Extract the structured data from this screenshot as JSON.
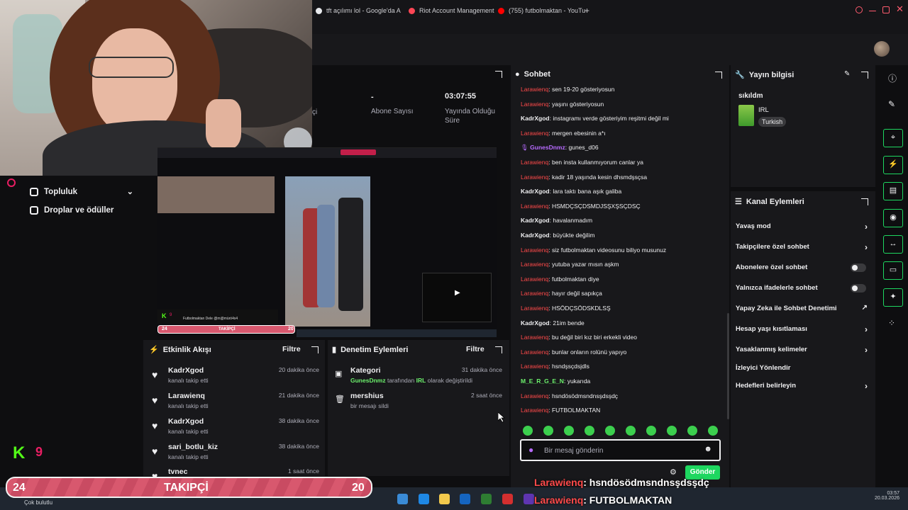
{
  "browser": {
    "tabs": [
      {
        "label": "tft açılımı lol - Google'da A",
        "color": "#e8eaed"
      },
      {
        "label": "Riot Account Management",
        "color": "#ff4655"
      },
      {
        "label": "(755) futbolmaktan - YouTu",
        "color": "#ff0000"
      }
    ],
    "new_tab_label": "+",
    "ai_label": "AI"
  },
  "stats": {
    "viewers_label_partial": "çi",
    "subs_value": "-",
    "subs_label": "Abone Sayısı",
    "uptime_value": "03:07:55",
    "uptime_label": "Yayında Olduğu Süre"
  },
  "leftnav": {
    "community": "Topluluk",
    "drops": "Droplar ve ödüller"
  },
  "preview": {
    "overlay_title": "Futbolmaktan Dele @m@mürö4x4",
    "banner_left": "24",
    "banner_mid": "TAKİPÇİ",
    "banner_right": "20",
    "kick_count": "9"
  },
  "activity": {
    "title": "Etkinlik Akışı",
    "filter": "Filtre",
    "items": [
      {
        "name": "KadrXgod",
        "sub": "kanalı takip etti",
        "time": "20 dakika önce"
      },
      {
        "name": "Larawienq",
        "sub": "kanalı takip etti",
        "time": "21 dakika önce"
      },
      {
        "name": "KadrXgod",
        "sub": "kanalı takip etti",
        "time": "38 dakika önce"
      },
      {
        "name": "sari_botlu_kiz",
        "sub": "kanalı takip etti",
        "time": "38 dakika önce"
      },
      {
        "name": "tvnec",
        "sub": "",
        "time": "1 saat önce"
      }
    ]
  },
  "moderation": {
    "title": "Denetim Eylemleri",
    "filter": "Filtre",
    "items": [
      {
        "name": "Kategori",
        "actor": "GunesDnmz",
        "mid": " tarafından ",
        "target": "IRL",
        "tail": " olarak değiştirildi",
        "time": "31 dakika önce"
      },
      {
        "name": "mershius",
        "sub": "bir mesajı sildi",
        "time": "2 saat önce"
      }
    ]
  },
  "chat": {
    "title": "Sohbet",
    "messages": [
      {
        "user": "Larawienq",
        "type": "lara",
        "text": "sen 19-20 gösteriyosun"
      },
      {
        "user": "Larawienq",
        "type": "lara",
        "text": "yaşını gösteriyosun"
      },
      {
        "user": "KadrXgod",
        "type": "kadr",
        "text": "instagramı verde gösteriyim reşitmi değil mi"
      },
      {
        "user": "Larawienq",
        "type": "lara",
        "text": "mergen ebesinin a*ı"
      },
      {
        "user": "GunesDnmz",
        "type": "gunes",
        "text": "gunes_d06"
      },
      {
        "user": "Larawienq",
        "type": "lara",
        "text": "ben insta kullanmıyorum canlar ya"
      },
      {
        "user": "Larawienq",
        "type": "lara",
        "text": "kadir 18 yaşında kesin dhsmdşsçsa"
      },
      {
        "user": "KadrXgod",
        "type": "kadr",
        "text": "lara taktı bana aşık galiba"
      },
      {
        "user": "Larawienq",
        "type": "lara",
        "text": "HSMDÇSÇDSMDJSŞXŞSÇDSÇ"
      },
      {
        "user": "KadrXgod",
        "type": "kadr",
        "text": "havalanmadım"
      },
      {
        "user": "KadrXgod",
        "type": "kadr",
        "text": "büyükte değilim"
      },
      {
        "user": "Larawienq",
        "type": "lara",
        "text": "siz futbolmaktan videosunu biliyo musunuz"
      },
      {
        "user": "Larawienq",
        "type": "lara",
        "text": "yutuba yazar mısın aşkm"
      },
      {
        "user": "Larawienq",
        "type": "lara",
        "text": "futbolmaktan diye"
      },
      {
        "user": "Larawienq",
        "type": "lara",
        "text": "hayır değil sapıkça"
      },
      {
        "user": "Larawienq",
        "type": "lara",
        "text": "HSÖDÇSÖDSKDLSŞ"
      },
      {
        "user": "KadrXgod",
        "type": "kadr",
        "text": "21im bende"
      },
      {
        "user": "Larawienq",
        "type": "lara",
        "text": "bu değil biri kız biri erkekli video"
      },
      {
        "user": "Larawienq",
        "type": "lara",
        "text": "bunlar onların rolünü yapıyo"
      },
      {
        "user": "Larawienq",
        "type": "lara",
        "text": "hsndşsçdsjdls"
      },
      {
        "user": "M_E_R_G_E_N",
        "type": "merg",
        "text": "yukarıda"
      },
      {
        "user": "Larawienq",
        "type": "lara",
        "text": "hsndösödmsndnsşdsşdç"
      },
      {
        "user": "Larawienq",
        "type": "lara",
        "text": "FUTBOLMAKTAN"
      }
    ],
    "input_placeholder": "Bir mesaj gönderin",
    "send_label": "Gönder"
  },
  "stream_info": {
    "title": "Yayın bilgisi",
    "stream_title": "sıkıldm",
    "category": "IRL",
    "language": "Turkish"
  },
  "channel_actions": {
    "title": "Kanal Eylemleri",
    "items": [
      {
        "label": "Yavaş mod",
        "kind": "chevron"
      },
      {
        "label": "Takipçilere özel sohbet",
        "kind": "chevron"
      },
      {
        "label": "Abonelere özel sohbet",
        "kind": "toggle"
      },
      {
        "label": "Yalnızca ifadelerle sohbet",
        "kind": "toggle"
      },
      {
        "label": "Yapay Zeka ile Sohbet Denetimi",
        "kind": "external"
      },
      {
        "label": "Hesap yaşı kısıtlaması",
        "kind": "chevron"
      },
      {
        "label": "Yasaklanmış kelimeler",
        "kind": "chevron"
      },
      {
        "label": "İzleyici Yönlendir",
        "kind": "none"
      },
      {
        "label": "Hedefleri belirleyin",
        "kind": "chevron"
      }
    ]
  },
  "overlay": {
    "banner_left": "24",
    "banner_mid": "TAKIPÇİ",
    "banner_right": "20",
    "kick_count": "9",
    "chat1_user": "Larawienq",
    "chat1_text": ": hsndösödmsndnsşdsşdç",
    "chat2_user": "Larawienq",
    "chat2_text": ": FUTBOLMAKTAN"
  },
  "taskbar": {
    "weather": "Çok bulutlu",
    "time": "03:57",
    "date": "20.03.2026"
  },
  "colors": {
    "accent": "#1ed760",
    "username_red": "#ff4a4a",
    "banner_pink": "#d8586e",
    "kick_green": "#53fc18"
  }
}
